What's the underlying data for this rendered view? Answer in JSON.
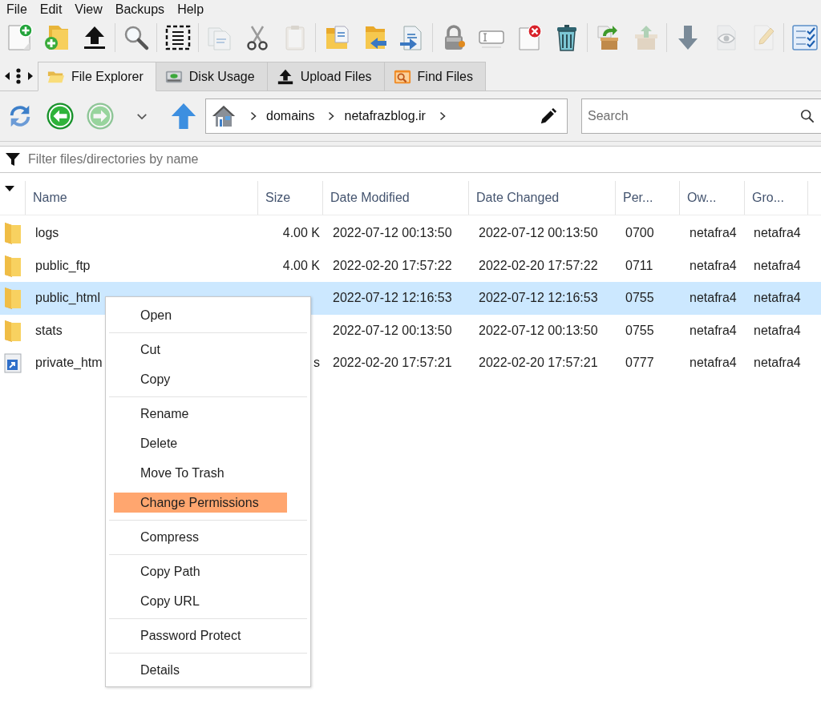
{
  "menu_bar": [
    "File",
    "Edit",
    "View",
    "Backups",
    "Help"
  ],
  "toolbar": [
    [
      {
        "kind": "new-file",
        "disabled": false
      },
      {
        "kind": "new-folder",
        "disabled": false
      },
      {
        "kind": "upload",
        "disabled": false
      }
    ],
    [
      {
        "kind": "search",
        "disabled": false
      }
    ],
    [
      {
        "kind": "select-all",
        "disabled": false
      }
    ],
    [
      {
        "kind": "copy",
        "disabled": true
      },
      {
        "kind": "cut",
        "disabled": false
      },
      {
        "kind": "paste",
        "disabled": true
      }
    ],
    [
      {
        "kind": "folder-document",
        "disabled": false
      },
      {
        "kind": "move",
        "disabled": false
      },
      {
        "kind": "copy-to",
        "disabled": false
      }
    ],
    [
      {
        "kind": "permissions",
        "disabled": false
      },
      {
        "kind": "rename",
        "disabled": false
      },
      {
        "kind": "delete",
        "disabled": false
      },
      {
        "kind": "trash",
        "disabled": false
      }
    ],
    [
      {
        "kind": "extract",
        "disabled": false
      },
      {
        "kind": "compress",
        "disabled": true
      }
    ],
    [
      {
        "kind": "download",
        "disabled": false
      },
      {
        "kind": "view",
        "disabled": true
      },
      {
        "kind": "edit",
        "disabled": true
      }
    ],
    [
      {
        "kind": "checklist",
        "disabled": false
      }
    ]
  ],
  "tab_strip": {
    "tabs": [
      {
        "label": "File Explorer",
        "kind": "explorer",
        "selected": true
      },
      {
        "label": "Disk Usage",
        "kind": "disk",
        "selected": false
      },
      {
        "label": "Upload Files",
        "kind": "upload",
        "selected": false
      },
      {
        "label": "Find Files",
        "kind": "find",
        "selected": false
      }
    ]
  },
  "nav_bar": {
    "buttons": [
      {
        "kind": "refresh",
        "disabled": false
      },
      {
        "kind": "back",
        "disabled": false
      },
      {
        "kind": "forward",
        "disabled": true
      },
      {
        "kind": "history",
        "disabled": false
      },
      {
        "kind": "up",
        "disabled": false
      }
    ],
    "breadcrumb": [
      "domains",
      "netafrazblog.ir"
    ],
    "search": {
      "placeholder": "Search"
    }
  },
  "filter": {
    "placeholder": "Filter files/directories by name"
  },
  "table": {
    "columns": [
      "Name",
      "Size",
      "Date Modified",
      "Date Changed",
      "Per...",
      "Ow...",
      "Gro..."
    ],
    "rows": [
      {
        "kind": "folder",
        "name": "logs",
        "size": "4.00 K",
        "modified": "2022-07-12 00:13:50",
        "changed": "2022-07-12 00:13:50",
        "permissions": "0700",
        "owner": "netafra4",
        "group": "netafra4",
        "selected": false
      },
      {
        "kind": "folder",
        "name": "public_ftp",
        "size": "4.00 K",
        "modified": "2022-02-20 17:57:22",
        "changed": "2022-02-20 17:57:22",
        "permissions": "0711",
        "owner": "netafra4",
        "group": "netafra4",
        "selected": false
      },
      {
        "kind": "folder",
        "name": "public_html",
        "modified": "2022-07-12 12:16:53",
        "changed": "2022-07-12 12:16:53",
        "permissions": "0755",
        "owner": "netafra4",
        "group": "netafra4",
        "selected": true
      },
      {
        "kind": "folder",
        "name": "stats",
        "modified": "2022-07-12 00:13:50",
        "changed": "2022-07-12 00:13:50",
        "permissions": "0755",
        "owner": "netafra4",
        "group": "netafra4",
        "selected": false
      },
      {
        "kind": "link",
        "name": "private_htm",
        "size": "s",
        "modified": "2022-02-20 17:57:21",
        "changed": "2022-02-20 17:57:21",
        "permissions": "0777",
        "owner": "netafra4",
        "group": "netafra4",
        "selected": false
      }
    ]
  },
  "context_menu": {
    "groups": [
      [
        {
          "label": "Open",
          "highlighted": false
        }
      ],
      [
        {
          "label": "Cut",
          "highlighted": false
        },
        {
          "label": "Copy",
          "highlighted": false
        }
      ],
      [
        {
          "label": "Rename",
          "highlighted": false
        },
        {
          "label": "Delete",
          "highlighted": false
        },
        {
          "label": "Move To Trash",
          "highlighted": false
        },
        {
          "label": "Change Permissions",
          "highlighted": true
        }
      ],
      [
        {
          "label": "Compress",
          "highlighted": false
        }
      ],
      [
        {
          "label": "Copy Path",
          "highlighted": false
        },
        {
          "label": "Copy URL",
          "highlighted": false
        }
      ],
      [
        {
          "label": "Password Protect",
          "highlighted": false
        }
      ],
      [
        {
          "label": "Details",
          "highlighted": false
        }
      ]
    ]
  }
}
